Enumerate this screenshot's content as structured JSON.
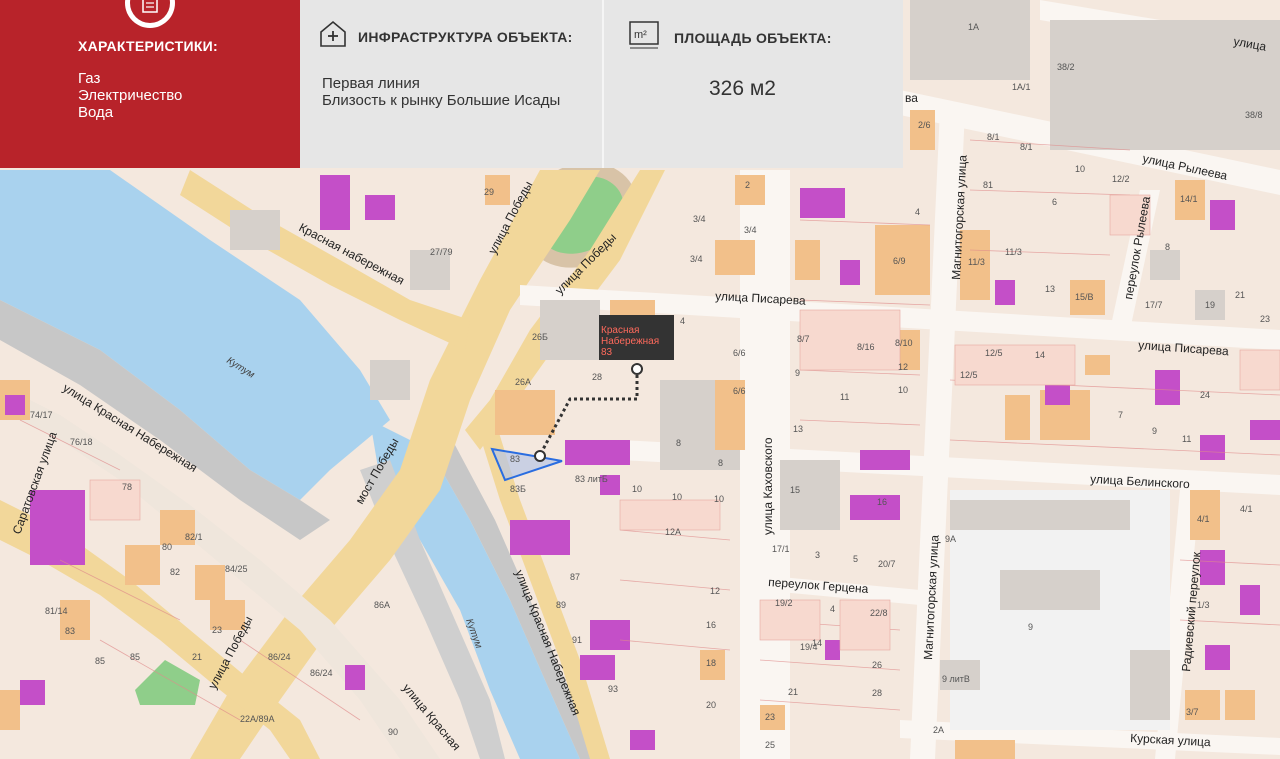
{
  "info_panel": {
    "characteristics": {
      "title": "ХАРАКТЕРИСТИКИ:",
      "items": [
        "Газ",
        "Электричество",
        "Вода"
      ],
      "icon": "document-icon"
    },
    "infrastructure": {
      "title": "ИНФРАСТРУКТУРА ОБЪЕКТА:",
      "items": [
        "Первая линия",
        "Близость к рынку Большие Исады"
      ],
      "icon": "building-plus-icon"
    },
    "area": {
      "title": "ПЛОЩАДЬ ОБЪЕКТА:",
      "value": "326 м2",
      "icon": "square-meters-icon",
      "icon_text": "m²"
    }
  },
  "marker": {
    "line1": "Красная",
    "line2": "Набережная 83"
  },
  "streets": {
    "krasnaya_top": "Красная набережная",
    "pobedy_1": "улица Победы",
    "pobedy_2": "улица Победы",
    "pobedy_3": "улица Победы",
    "krasnaya_left": "улица Красная Набережная",
    "saratovskaya": "Саратовская улица",
    "most": "мост Победы",
    "krasnaya_main": "улица Красная Набережная",
    "krasnaya_bottom": "улица Красная",
    "pisareva_1": "улица Писарева",
    "pisareva_2": "улица Писарева",
    "kakhovskogo": "улица Каховского",
    "magnitogorskaya_1": "Магнитогорская улица",
    "magnitogorskaya_2": "Магнитогорская улица",
    "ryleeva": "улица Рылеева",
    "per_ryleeva": "переулок Рылеева",
    "belinskogo": "улица Белинского",
    "gertsena": "переулок Герцена",
    "radievsky": "Радиевский переулок",
    "kurskaya": "Курская улица",
    "top_right": "улица",
    "top_va": "ва",
    "kutum_1": "Кутум",
    "kutum_2": "Кутум"
  },
  "house_numbers": {
    "n29": "29",
    "n27": "27/79",
    "n34": "3/4",
    "n34b": "3/4",
    "n34c": "3/4",
    "n2": "2",
    "n26": "2/6",
    "n81": "8/1",
    "n81b": "8/1",
    "n10": "10",
    "n122": "12/2",
    "n141": "14/1",
    "n4": "4",
    "n6": "6",
    "n69": "6/9",
    "n113": "11/3",
    "n113b": "11/3",
    "n13": "13",
    "n15b": "15/В",
    "n177": "17/7",
    "n19": "19",
    "n21": "21",
    "n23": "23",
    "n1a": "1А",
    "n382": "38/2",
    "n1a1": "1А/1",
    "n388": "38/8",
    "n8": "8",
    "n4b": "4",
    "n26b": "26Б",
    "n28": "28",
    "n26a": "26А",
    "n81c": "81",
    "n83": "83",
    "n83b": "83Б",
    "n87": "8/7",
    "n816": "8/16",
    "n810": "8/10",
    "n66": "6/6",
    "n66b": "6/6",
    "n9": "9",
    "n12": "12",
    "n11": "11",
    "n10b": "10",
    "n13b": "13",
    "n8b": "8",
    "n8c": "8",
    "n10c": "10",
    "n10d": "10",
    "n10e": "10",
    "n12a": "12А",
    "n15": "15",
    "n16": "16",
    "n171": "17/1",
    "n3": "3",
    "n5": "5",
    "n207": "20/7",
    "n125": "12/5",
    "n125b": "12/5",
    "n14": "14",
    "n7": "7",
    "n9b": "9",
    "n11b": "11",
    "n24": "24",
    "n9a": "9А",
    "n41": "4/1",
    "n41b": "4/1",
    "n13c": "1/3",
    "n9c": "9",
    "n9d": "9 литВ",
    "n37": "3/7",
    "n2a": "2А",
    "n7478": "74/17",
    "n7618": "76/18",
    "n78": "78",
    "n80": "80",
    "n821": "82/1",
    "n82": "82",
    "n8425": "84/25",
    "n8114": "81/14",
    "n83c": "83",
    "n85": "85",
    "n85b": "85",
    "n21b": "21",
    "n23b": "23",
    "n8624": "86/24",
    "n8624b": "86/24",
    "n22a": "22А/89А",
    "n90": "90",
    "n86a": "86А",
    "n87b": "87",
    "n89": "89",
    "n91": "91",
    "n93": "93",
    "n12b": "12",
    "n16b": "16",
    "n18": "18",
    "n20": "20",
    "n192": "19/2",
    "n228": "22/8",
    "n194": "19/4",
    "n26c": "26",
    "n28b": "28",
    "n21c": "21",
    "n23c": "23",
    "n25": "25",
    "n4c": "4",
    "n14b": "14",
    "n831": "83 литБ"
  }
}
